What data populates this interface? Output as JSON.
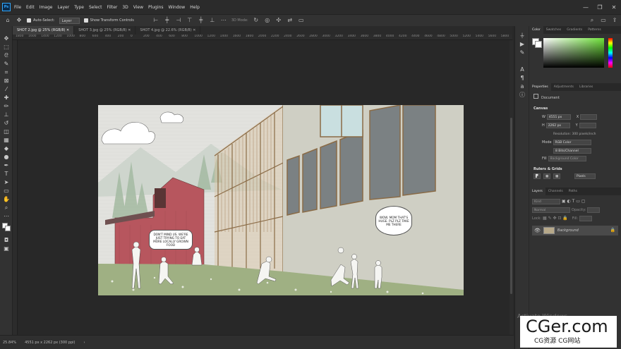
{
  "app": {
    "logo": "Ps",
    "menu": [
      "File",
      "Edit",
      "Image",
      "Layer",
      "Type",
      "Select",
      "Filter",
      "3D",
      "View",
      "Plugins",
      "Window",
      "Help"
    ],
    "window_controls": [
      "—",
      "❐",
      "✕"
    ]
  },
  "options": {
    "auto_select": "Auto-Select:",
    "layer_select": "Layer",
    "transform_controls": "Show Transform Controls",
    "mode_3d": "3D Mode:"
  },
  "tabs": [
    "SHOT 2.jpg @ 25% (RGB/8)",
    "SHOT 3.jpg @ 25% (RGB/8)",
    "SHOT 4.jpg @ 22.6% (RGB/8)"
  ],
  "ruler": [
    "1800",
    "1600",
    "1400",
    "1200",
    "1000",
    "800",
    "600",
    "400",
    "200",
    "0",
    "200",
    "400",
    "600",
    "800",
    "1000",
    "1200",
    "1400",
    "1600",
    "1800",
    "2000",
    "2200",
    "2400",
    "2600",
    "2800",
    "3000",
    "3200",
    "3400",
    "3600",
    "3800",
    "4000",
    "4200",
    "4400",
    "4600",
    "4800",
    "5000",
    "5200",
    "5400",
    "5600",
    "5800"
  ],
  "status": {
    "zoom": "25.84%",
    "doc_size": "4551 px x 2262 px (300 ppi)"
  },
  "color_panel": {
    "tabs": [
      "Color",
      "Swatches",
      "Gradients",
      "Patterns"
    ]
  },
  "props_panel": {
    "tabs": [
      "Properties",
      "Adjustments",
      "Libraries"
    ],
    "doc_label": "Document",
    "canvas_title": "Canvas",
    "w_label": "W",
    "w_value": "4551 px",
    "h_label": "H",
    "h_value": "2262 px",
    "x_label": "X",
    "y_label": "Y",
    "resolution": "Resolution: 300 pixels/inch",
    "mode_label": "Mode",
    "mode_value": "RGB Color",
    "depth_value": "8 Bits/Channel",
    "fill_label": "Fill",
    "fill_value": "Background Color",
    "rulers_title": "Rulers & Grids",
    "units_value": "Pixels"
  },
  "layers_panel": {
    "tabs": [
      "Layers",
      "Channels",
      "Paths"
    ],
    "kind_placeholder": "Kind",
    "blend": "Normal",
    "opacity_label": "Opacity:",
    "lock_label": "Lock:",
    "fill_label": "Fill:",
    "layer_name": "Background"
  },
  "windows_notice": "Activate Windows",
  "watermark": {
    "big": "CGer.com",
    "small": "CG资源 CG网站"
  },
  "bubbles": {
    "left": "DON'T MIND US. WE'RE JUST TRYING TO EAT MORE LOCALLY GROWN FOOD",
    "right": "WOW. MOM THAT'S HUGE. PLZ PLZ TAKE ME THERE"
  },
  "colors": {
    "accent": "#31a8ff",
    "barn": "#b7565e",
    "facade": "#cfcfc4",
    "grass": "#9fb083"
  }
}
